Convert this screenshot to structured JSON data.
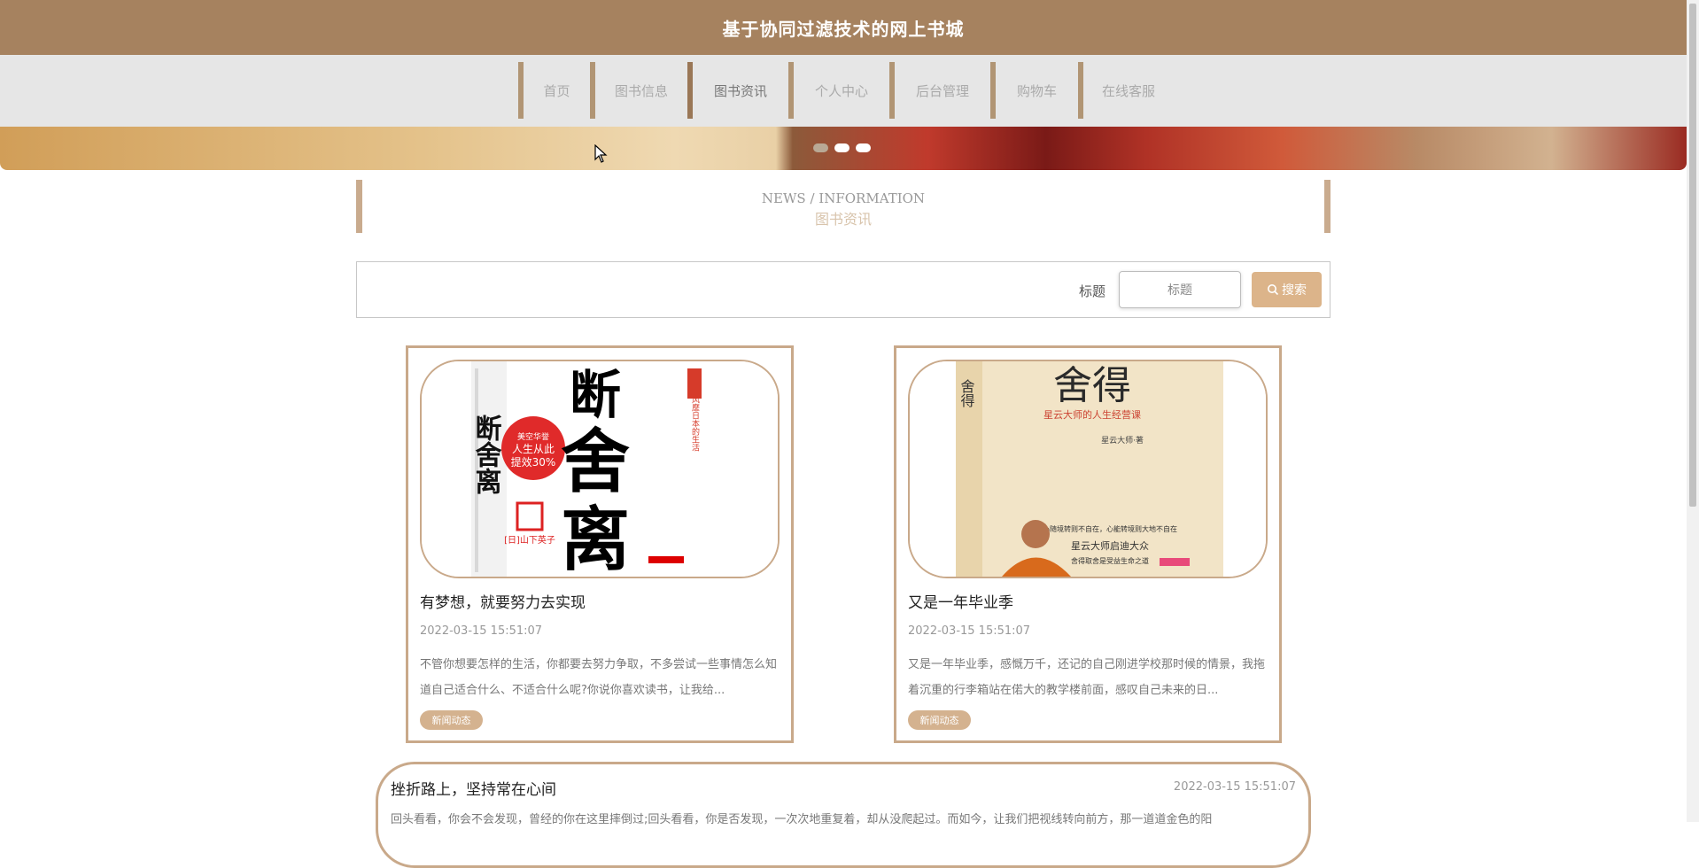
{
  "header": {
    "title": "基于协同过滤技术的网上书城"
  },
  "nav": {
    "items": [
      {
        "label": "首页"
      },
      {
        "label": "图书信息"
      },
      {
        "label": "图书资讯"
      },
      {
        "label": "个人中心"
      },
      {
        "label": "后台管理"
      },
      {
        "label": "购物车"
      },
      {
        "label": "在线客服"
      }
    ],
    "active_index": 2
  },
  "banner": {
    "slides": 3,
    "active_slide": 1
  },
  "section": {
    "title_en": "NEWS / INFORMATION",
    "title_cn": "图书资讯"
  },
  "search": {
    "label": "标题",
    "placeholder": "标题",
    "button_label": "搜索",
    "button_icon": "search-icon"
  },
  "news": [
    {
      "title": "有梦想，就要努力去实现",
      "time": "2022-03-15 15:51:07",
      "desc": "不管你想要怎样的生活，你都要去努力争取，不多尝试一些事情怎么知道自己适合什么、不适合什么呢?你说你喜欢读书，让我给...",
      "tag": "新闻动态",
      "cover_text": "断舍离"
    },
    {
      "title": "又是一年毕业季",
      "time": "2022-03-15 15:51:07",
      "desc": "又是一年毕业季，感慨万千，还记的自己刚进学校那时候的情景，我拖着沉重的行李箱站在偌大的教学楼前面，感叹自己未来的日...",
      "tag": "新闻动态",
      "cover_text": "舍得"
    },
    {
      "title": "挫折路上，坚持常在心间",
      "time": "2022-03-15 15:51:07",
      "desc": "回头看看，你会不会发现，曾经的你在这里摔倒过;回头看看，你是否发现，一次次地重复着，却从没爬起过。而如今，让我们把视线转向前方，那一道道金色的阳"
    }
  ],
  "colors": {
    "brand": "#a6825f",
    "accent": "#c9a98a",
    "button": "#dcb48a"
  }
}
